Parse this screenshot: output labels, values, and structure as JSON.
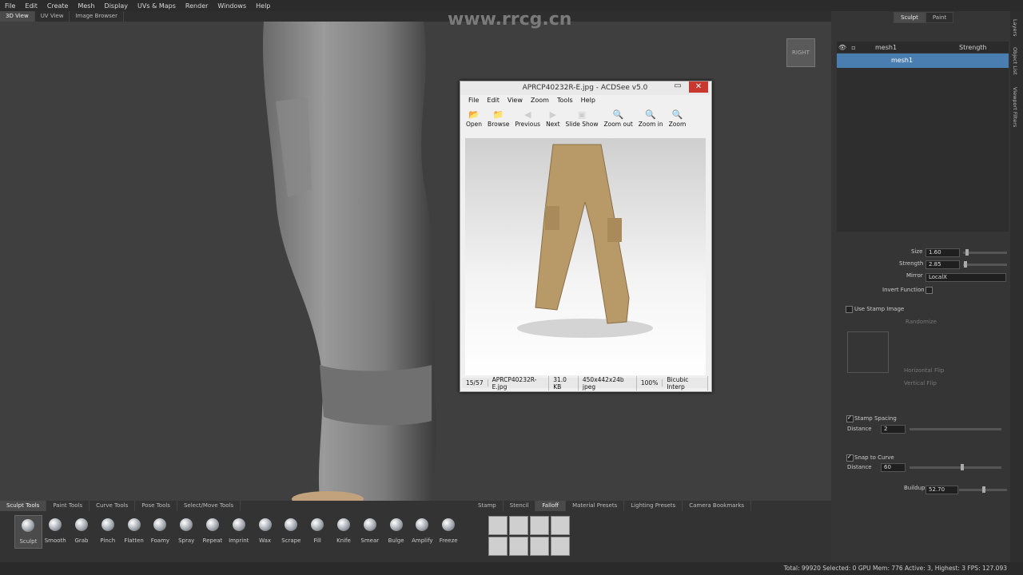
{
  "menubar": [
    "File",
    "Edit",
    "Create",
    "Mesh",
    "Display",
    "UVs & Maps",
    "Render",
    "Windows",
    "Help"
  ],
  "view_tabs": [
    {
      "label": "3D View",
      "active": true
    },
    {
      "label": "UV View",
      "active": false
    },
    {
      "label": "Image Browser",
      "active": false
    }
  ],
  "watermark": "www.rrcg.cn",
  "view_cube_label": "RIGHT",
  "acdsee": {
    "title": "APRCP40232R-E.jpg - ACDSee v5.0",
    "menu": [
      "File",
      "Edit",
      "View",
      "Zoom",
      "Tools",
      "Help"
    ],
    "toolbar": [
      {
        "label": "Open",
        "icon": "folder-open-icon",
        "glyph": "📂"
      },
      {
        "label": "Browse",
        "icon": "browse-icon",
        "glyph": "📁"
      },
      {
        "label": "Previous",
        "icon": "previous-icon",
        "glyph": "◀"
      },
      {
        "label": "Next",
        "icon": "next-icon",
        "glyph": "▶"
      },
      {
        "label": "Slide Show",
        "icon": "slideshow-icon",
        "glyph": "▣"
      },
      {
        "label": "Zoom out",
        "icon": "zoom-out-icon",
        "glyph": "🔍"
      },
      {
        "label": "Zoom in",
        "icon": "zoom-in-icon",
        "glyph": "🔍"
      },
      {
        "label": "Zoom",
        "icon": "zoom-icon",
        "glyph": "🔍"
      }
    ],
    "status": [
      "15/57",
      "APRCP40232R-E.jpg",
      "31.0 KB",
      "450x442x24b jpeg",
      "100%",
      "Bicubic Interp"
    ]
  },
  "right_panel": {
    "tabs": [
      {
        "label": "Sculpt",
        "active": true
      },
      {
        "label": "Paint",
        "active": false
      }
    ],
    "layer_header": {
      "name": "mesh1",
      "strength": "Strength"
    },
    "layer_row": "mesh1",
    "side_tabs": [
      "Layers",
      "Object List",
      "Viewport Filters"
    ],
    "props": {
      "size_label": "Size",
      "size_value": "1.60",
      "strength_label": "Strength",
      "strength_value": "2.85",
      "mirror_label": "Mirror",
      "mirror_value": "LocalX",
      "invert_label": "Invert Function",
      "stamp_image_label": "Use Stamp Image",
      "randomize_label": "Randomize",
      "hflip_label": "Horizontal Flip",
      "vflip_label": "Vertical Flip",
      "stamp_spacing_label": "Stamp Spacing",
      "distance_label": "Distance",
      "distance_value": "2",
      "snap_label": "Snap to Curve",
      "snap_distance_label": "Distance",
      "snap_distance_value": "60",
      "buildup_label": "Buildup",
      "buildup_value": "52.70"
    }
  },
  "tool_tabs": [
    {
      "label": "Sculpt Tools",
      "active": true
    },
    {
      "label": "Paint Tools",
      "active": false
    },
    {
      "label": "Curve Tools",
      "active": false
    },
    {
      "label": "Pose Tools",
      "active": false
    },
    {
      "label": "Select/Move Tools",
      "active": false
    }
  ],
  "tools": [
    "Sculpt",
    "Smooth",
    "Grab",
    "Pinch",
    "Flatten",
    "Foamy",
    "Spray",
    "Repeat",
    "Imprint",
    "Wax",
    "Scrape",
    "Fill",
    "Knife",
    "Smear",
    "Bulge",
    "Amplify",
    "Freeze"
  ],
  "stamp_tabs": [
    {
      "label": "Stamp",
      "active": false
    },
    {
      "label": "Stencil",
      "active": false
    },
    {
      "label": "Falloff",
      "active": true
    },
    {
      "label": "Material Presets",
      "active": false
    },
    {
      "label": "Lighting Presets",
      "active": false
    },
    {
      "label": "Camera Bookmarks",
      "active": false
    }
  ],
  "status_text": "Total: 99920  Selected: 0  GPU Mem: 776  Active: 3, Highest: 3  FPS: 127.093"
}
